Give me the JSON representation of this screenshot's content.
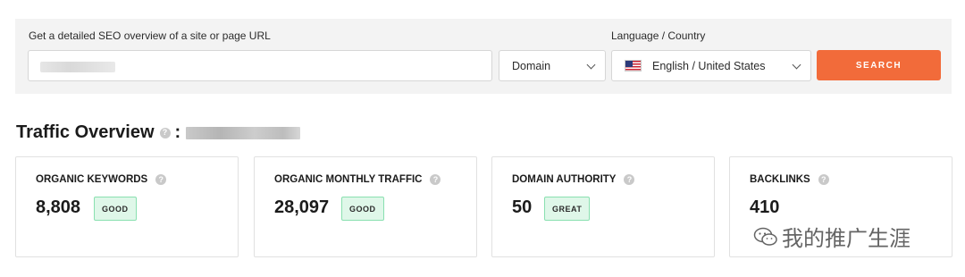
{
  "search": {
    "label": "Get a detailed SEO overview of a site or page URL",
    "url_value": "",
    "type_select": "Domain",
    "lang_label": "Language / Country",
    "lang_select": "English / United States",
    "button_label": "SEARCH"
  },
  "overview": {
    "title": "Traffic Overview",
    "colon": ":",
    "help": "?"
  },
  "metrics": [
    {
      "title": "ORGANIC KEYWORDS",
      "value": "8,808",
      "badge": "GOOD"
    },
    {
      "title": "ORGANIC MONTHLY TRAFFIC",
      "value": "28,097",
      "badge": "GOOD"
    },
    {
      "title": "DOMAIN AUTHORITY",
      "value": "50",
      "badge": "GREAT"
    },
    {
      "title": "BACKLINKS",
      "value": "410",
      "badge": ""
    }
  ],
  "watermark": {
    "text": "我的推广生涯"
  },
  "colors": {
    "accent": "#f26b3a",
    "badge_bg": "#dff7e9",
    "badge_border": "#89e0b0",
    "panel_bg": "#f3f3f3"
  },
  "icons": {
    "help": "help-circle-icon",
    "dropdown": "chevron-down-icon",
    "flag": "us-flag-icon",
    "watermark": "wechat-icon"
  }
}
